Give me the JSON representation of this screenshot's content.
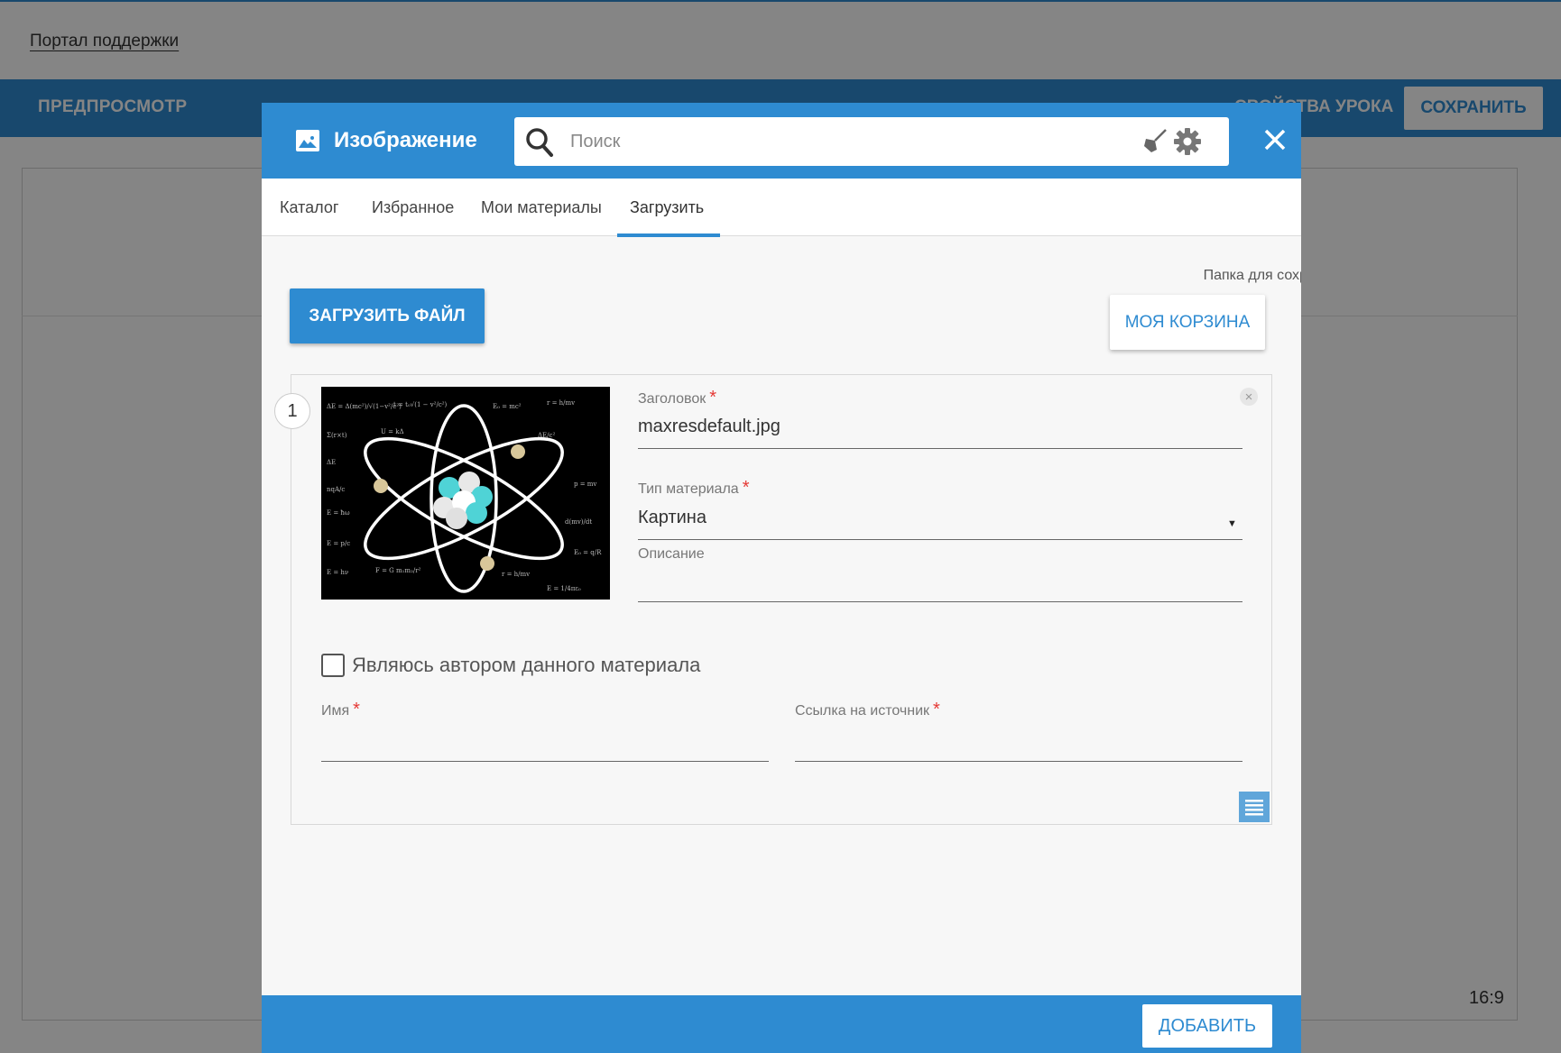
{
  "background": {
    "support_link": "Портал поддержки",
    "preview_label": "ПРЕДПРОСМОТР",
    "lesson_props_label": "СВОЙСТВА УРОКА",
    "save_label": "СОХРАНИТЬ",
    "aspect_ratio": "16:9"
  },
  "modal": {
    "title": "Изображение",
    "title_icon": "image-icon",
    "search": {
      "placeholder": "Поиск",
      "value": ""
    },
    "tabs": [
      {
        "label": "Каталог",
        "active": false
      },
      {
        "label": "Избранное",
        "active": false
      },
      {
        "label": "Мои материалы",
        "active": false
      },
      {
        "label": "Загрузить",
        "active": true
      }
    ],
    "upload_button": "ЗАГРУЗИТЬ ФАЙЛ",
    "folder_label": "Папка для сохранения",
    "folder_button": "МОЯ КОРЗИНА",
    "item": {
      "number": "1",
      "title_label": "Заголовок",
      "title_value": "maxresdefault.jpg",
      "type_label": "Тип материала",
      "type_value": "Картина",
      "description_label": "Описание",
      "description_value": "",
      "author_checkbox_label": "Являюсь автором данного материала",
      "author_checked": false,
      "name_label": "Имя",
      "name_value": "",
      "source_label": "Ссылка на источник",
      "source_value": ""
    },
    "add_button": "ДОБАВИТЬ"
  },
  "colors": {
    "accent": "#2e8bd1",
    "required": "#e53935",
    "overlay": "rgba(0,0,0,0.48)"
  }
}
